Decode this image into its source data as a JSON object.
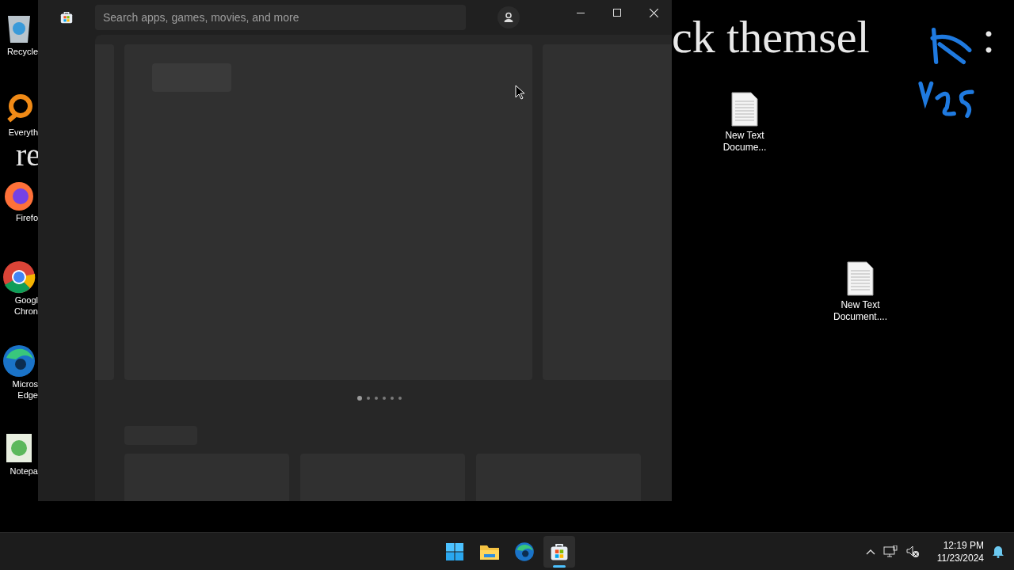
{
  "desktop": {
    "overlay_text": [
      {
        "text": "ck themsel",
        "kind": "heading"
      },
      {
        "text": ":",
        "kind": "heading"
      },
      {
        "text": "re",
        "kind": "fragment"
      }
    ],
    "left_icons": [
      {
        "kind": "recycle",
        "lines": [
          "Recycle"
        ]
      },
      {
        "kind": "everything",
        "lines": [
          "Everyth"
        ]
      },
      {
        "kind": "firefox",
        "lines": [
          "Firefo"
        ]
      },
      {
        "kind": "chrome",
        "lines": [
          "Googl",
          "Chron"
        ]
      },
      {
        "kind": "edge",
        "lines": [
          "Micros",
          "Edge"
        ]
      },
      {
        "kind": "notepad",
        "lines": [
          "Notepa"
        ]
      }
    ],
    "file_icons": [
      {
        "kind": "textfile",
        "lines": [
          "New Text",
          "Docume..."
        ]
      },
      {
        "kind": "textfile",
        "lines": [
          "New Text",
          "Document...."
        ]
      }
    ]
  },
  "window": {
    "search": {
      "placeholder": "Search apps, games, movies, and more"
    },
    "carousel_dots": [
      {
        "selected": true
      },
      {
        "selected": false
      },
      {
        "selected": false
      },
      {
        "selected": false
      },
      {
        "selected": false
      },
      {
        "selected": false
      }
    ]
  },
  "taskbar": {
    "apps": [
      {
        "kind": "start",
        "selected": false
      },
      {
        "kind": "explorer",
        "selected": false
      },
      {
        "kind": "edge",
        "selected": false
      },
      {
        "kind": "store",
        "selected": true
      }
    ],
    "time": "12:19 PM",
    "date": "11/23/2024"
  }
}
